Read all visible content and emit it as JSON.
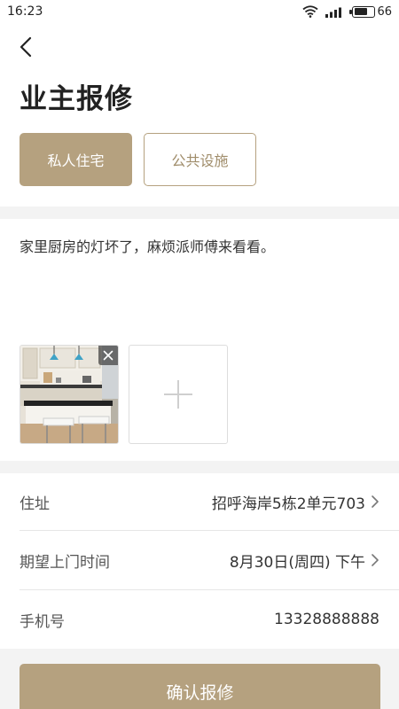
{
  "status_bar": {
    "time": "16:23",
    "battery": "66",
    "battery_level": 0.66
  },
  "page": {
    "title": "业主报修"
  },
  "type_tabs": [
    {
      "label": "私人住宅",
      "selected": true
    },
    {
      "label": "公共设施",
      "selected": false
    }
  ],
  "description": "家里厨房的灯坏了，麻烦派师傅来看看。",
  "icons": {
    "back": "chevron-left-icon",
    "close": "close-icon",
    "add": "plus-icon",
    "arrow": "chevron-right-icon"
  },
  "form": {
    "address": {
      "label": "住址",
      "value": "招呼海岸5栋2单元703"
    },
    "visit_time": {
      "label": "期望上门时间",
      "value": "8月30日(周四) 下午"
    },
    "phone": {
      "label": "手机号",
      "value": "13328888888"
    }
  },
  "submit_label": "确认报修",
  "colors": {
    "accent": "#b5a17f",
    "divider": "#f3f3f3"
  }
}
